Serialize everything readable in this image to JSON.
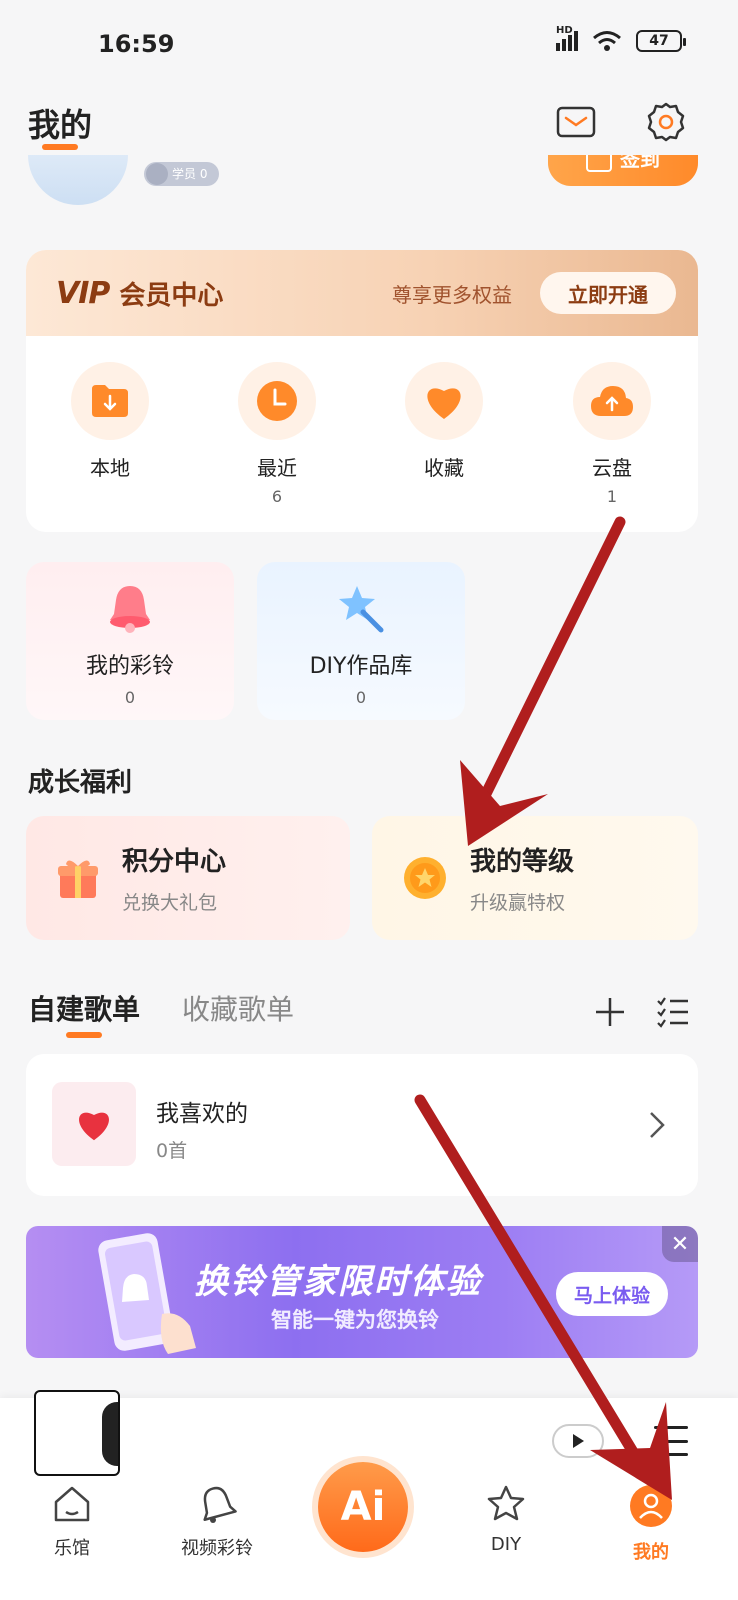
{
  "status_bar": {
    "time": "16:59",
    "network": "HD",
    "battery": "47"
  },
  "header": {
    "title": "我的"
  },
  "profile": {
    "member_badge": "学员 0",
    "checkin_label": "签到"
  },
  "vip": {
    "logo": "VIP",
    "title": "会员中心",
    "subtitle": "尊享更多权益",
    "button": "立即开通"
  },
  "quick_actions": [
    {
      "label": "本地",
      "count": ""
    },
    {
      "label": "最近",
      "count": "6"
    },
    {
      "label": "收藏",
      "count": ""
    },
    {
      "label": "云盘",
      "count": "1"
    }
  ],
  "features": [
    {
      "label": "我的彩铃",
      "count": "0"
    },
    {
      "label": "DIY作品库",
      "count": "0"
    }
  ],
  "growth": {
    "title": "成长福利",
    "items": [
      {
        "title": "积分中心",
        "subtitle": "兑换大礼包"
      },
      {
        "title": "我的等级",
        "subtitle": "升级赢特权"
      }
    ]
  },
  "playlists": {
    "tabs": [
      "自建歌单",
      "收藏歌单"
    ],
    "items": [
      {
        "name": "我喜欢的",
        "count": "0首"
      }
    ]
  },
  "ad": {
    "title": "换铃管家限时体验",
    "subtitle": "智能一键为您换铃",
    "button": "马上体验"
  },
  "nav": [
    {
      "label": "乐馆",
      "icon": "home-icon"
    },
    {
      "label": "视频彩铃",
      "icon": "bell-icon"
    },
    {
      "label": "Ai",
      "icon": "ai-icon"
    },
    {
      "label": "DIY",
      "icon": "star-icon"
    },
    {
      "label": "我的",
      "icon": "user-icon"
    }
  ],
  "colors": {
    "accent": "#ff7a22",
    "vip_brown": "#8c3c12",
    "ad_purple": "#8d6ff0"
  }
}
